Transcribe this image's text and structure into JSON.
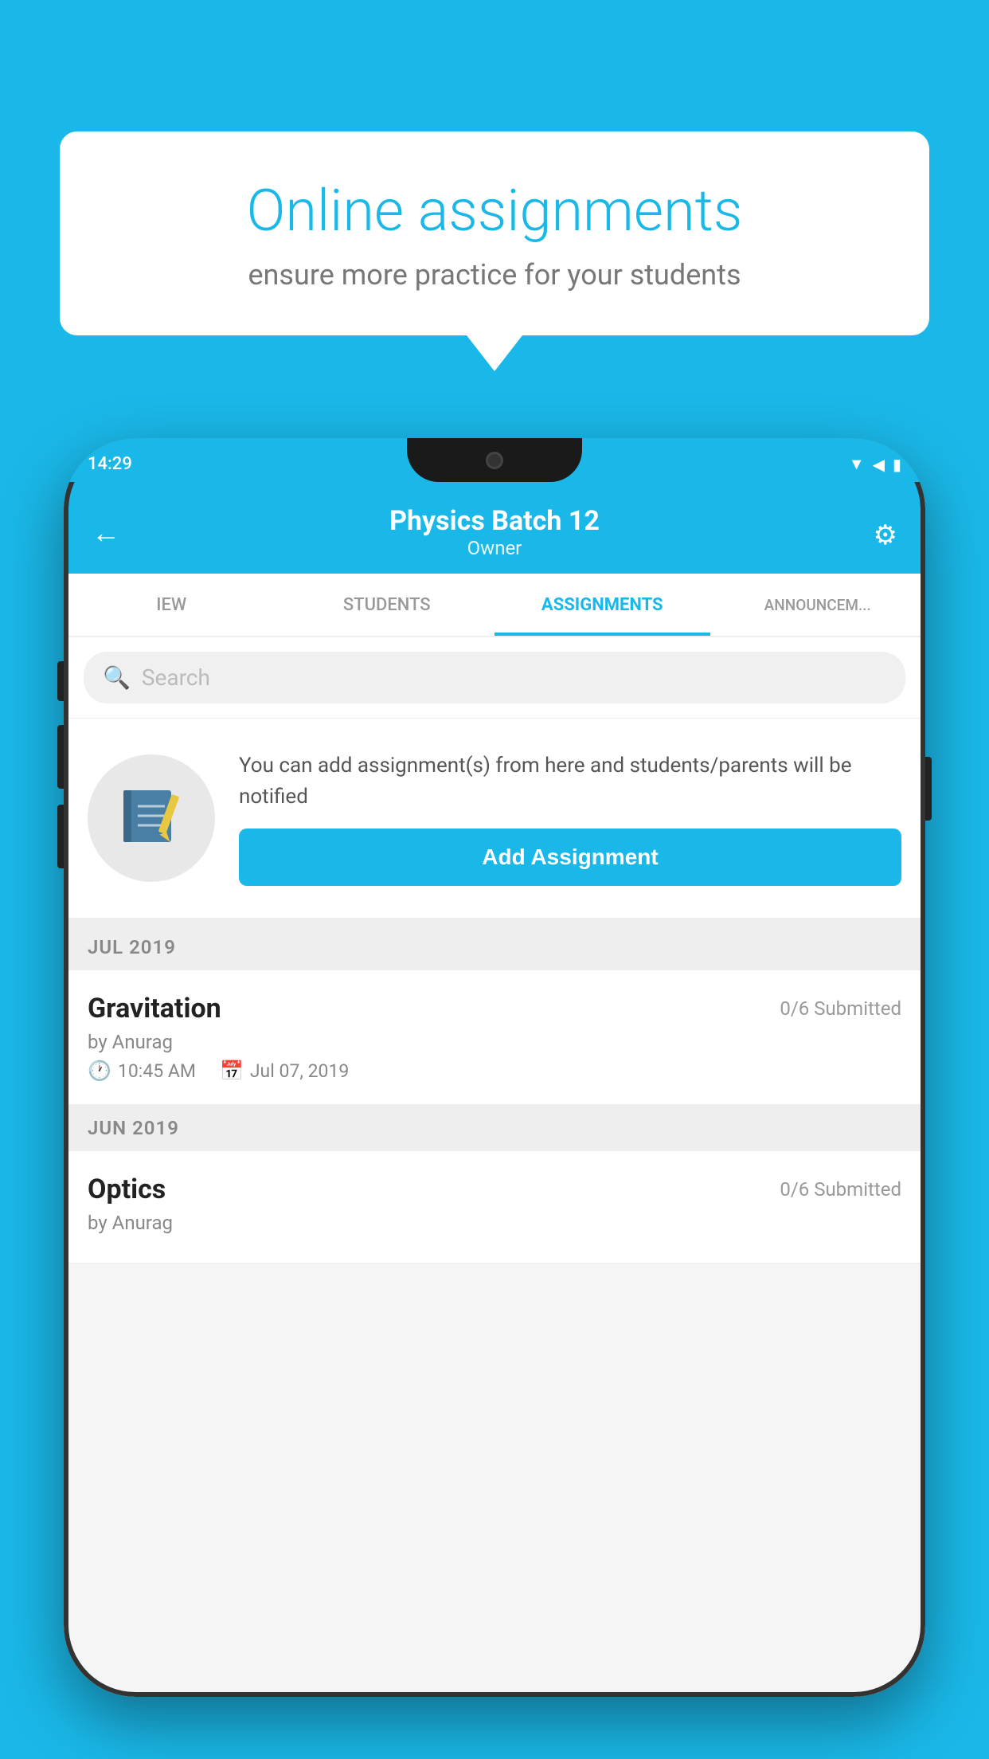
{
  "background_color": "#1ab8e8",
  "speech_bubble": {
    "title": "Online assignments",
    "subtitle": "ensure more practice for your students"
  },
  "status_bar": {
    "time": "14:29",
    "wifi": "▲",
    "signal": "▲",
    "battery": "▮"
  },
  "top_bar": {
    "title": "Physics Batch 12",
    "subtitle": "Owner",
    "back_icon": "←",
    "settings_icon": "⚙"
  },
  "tabs": [
    {
      "label": "IEW",
      "active": false
    },
    {
      "label": "STUDENTS",
      "active": false
    },
    {
      "label": "ASSIGNMENTS",
      "active": true
    },
    {
      "label": "ANNOUNCEM...",
      "active": false
    }
  ],
  "search": {
    "placeholder": "Search"
  },
  "promo": {
    "description": "You can add assignment(s) from here and students/parents will be notified",
    "button_label": "Add Assignment"
  },
  "sections": [
    {
      "label": "JUL 2019",
      "assignments": [
        {
          "name": "Gravitation",
          "submitted": "0/6 Submitted",
          "by": "by Anurag",
          "time": "10:45 AM",
          "date": "Jul 07, 2019"
        }
      ]
    },
    {
      "label": "JUN 2019",
      "assignments": [
        {
          "name": "Optics",
          "submitted": "0/6 Submitted",
          "by": "by Anurag",
          "time": "",
          "date": ""
        }
      ]
    }
  ]
}
